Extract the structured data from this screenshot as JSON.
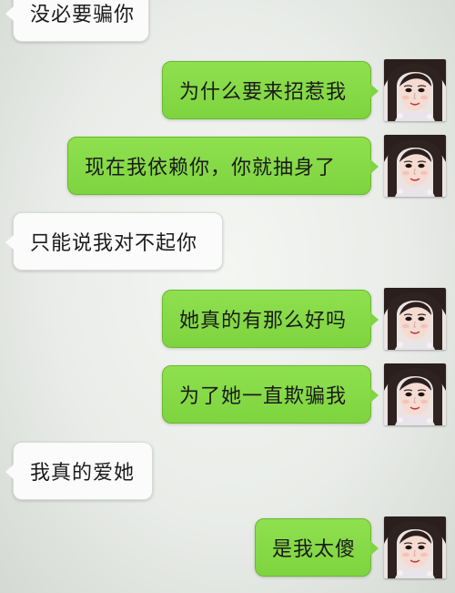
{
  "chat": {
    "messages": [
      {
        "side": "received",
        "text": "没必要骗你"
      },
      {
        "side": "sent",
        "text": "为什么要来招惹我",
        "avatar": "user-avatar"
      },
      {
        "side": "sent",
        "text": "现在我依赖你，你就抽身了",
        "avatar": "user-avatar"
      },
      {
        "side": "received",
        "text": "只能说我对不起你"
      },
      {
        "side": "sent",
        "text": "她真的有那么好吗",
        "avatar": "user-avatar"
      },
      {
        "side": "sent",
        "text": "为了她一直欺骗我",
        "avatar": "user-avatar"
      },
      {
        "side": "received",
        "text": "我真的爱她"
      },
      {
        "side": "sent",
        "text": "是我太傻",
        "avatar": "user-avatar"
      }
    ]
  },
  "colors": {
    "sent_bubble": "#84d846",
    "received_bubble": "#fbfbfb",
    "background": "#eceeeb"
  }
}
